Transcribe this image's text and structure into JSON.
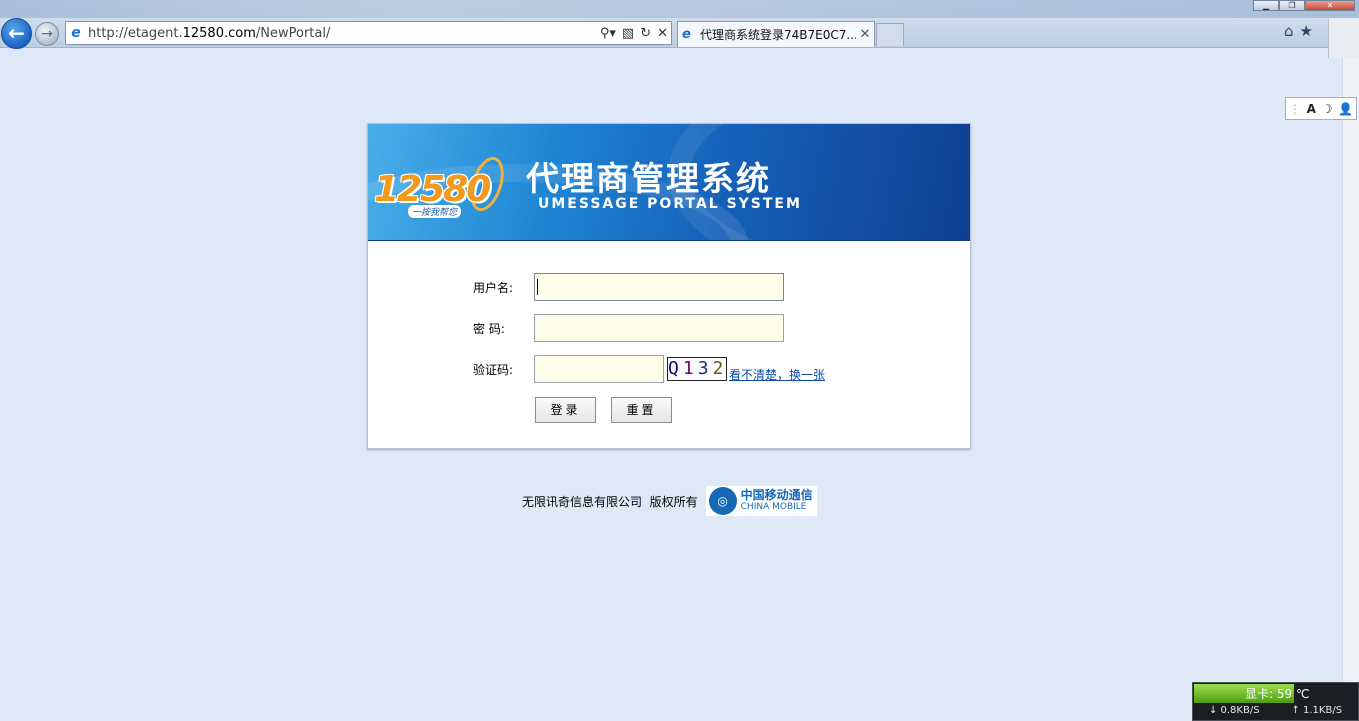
{
  "browser": {
    "url_scheme": "http://etagent.",
    "url_host": "12580.com",
    "url_path": "/NewPortal/",
    "tab_title": "代理商系统登录74B7E0C7..."
  },
  "banner": {
    "logo_number": "12580",
    "logo_tagline": "一按我帮您",
    "title_cn": "代理商管理系统",
    "title_en": "UMESSAGE PORTAL SYSTEM"
  },
  "form": {
    "username_label": "用户名:",
    "username_value": "",
    "password_label": "密 码:",
    "password_value": "",
    "captcha_label": "验证码:",
    "captcha_value": "",
    "captcha_chars": [
      "Q",
      "1",
      "3",
      "2"
    ],
    "refresh_link": "看不清楚，换一张",
    "login_button": "登录",
    "reset_button": "重置"
  },
  "footer": {
    "copyright": "无限讯奇信息有限公司  版权所有",
    "cm_cn": "中国移动通信",
    "cm_en": "CHINA MOBILE"
  },
  "gpu_widget": {
    "label": "显卡: 59 ℃",
    "down": "0.8KB/S",
    "up": "1.1KB/S"
  },
  "colors": {
    "page_bg": "#dfe8f6",
    "banner_blue": "#1560b8",
    "input_bg": "#fefde9",
    "link": "#0b4aa8"
  }
}
